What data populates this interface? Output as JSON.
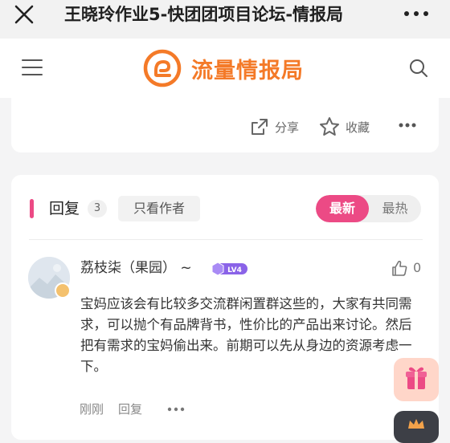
{
  "topbar": {
    "title": "王晓玲作业5-快团团项目论坛-情报局",
    "close_icon": "close-icon",
    "more_icon": "more-horizontal-icon"
  },
  "header": {
    "brand": "流量情报局",
    "brand_color": "#f47a28",
    "menu_icon": "hamburger-menu-icon",
    "search_icon": "search-icon"
  },
  "post_actions": {
    "share": "分享",
    "collect": "收藏"
  },
  "replies": {
    "title": "回复",
    "count": "3",
    "only_author": "只看作者",
    "sort_newest": "最新",
    "sort_hottest": "最热",
    "accent": "#ec4a85"
  },
  "comment": {
    "user": "荔枝柒（果园） ~",
    "level": "LV4",
    "likes": "0",
    "text": "宝妈应该会有比较多交流群闲置群这些的，大家有共同需求，可以抛个有品牌背书，性价比的产品出来讨论。然后把有需求的宝妈偷出来。前期可以先从身边的资源考虑一下。",
    "time": "刚刚",
    "reply": "回复"
  }
}
